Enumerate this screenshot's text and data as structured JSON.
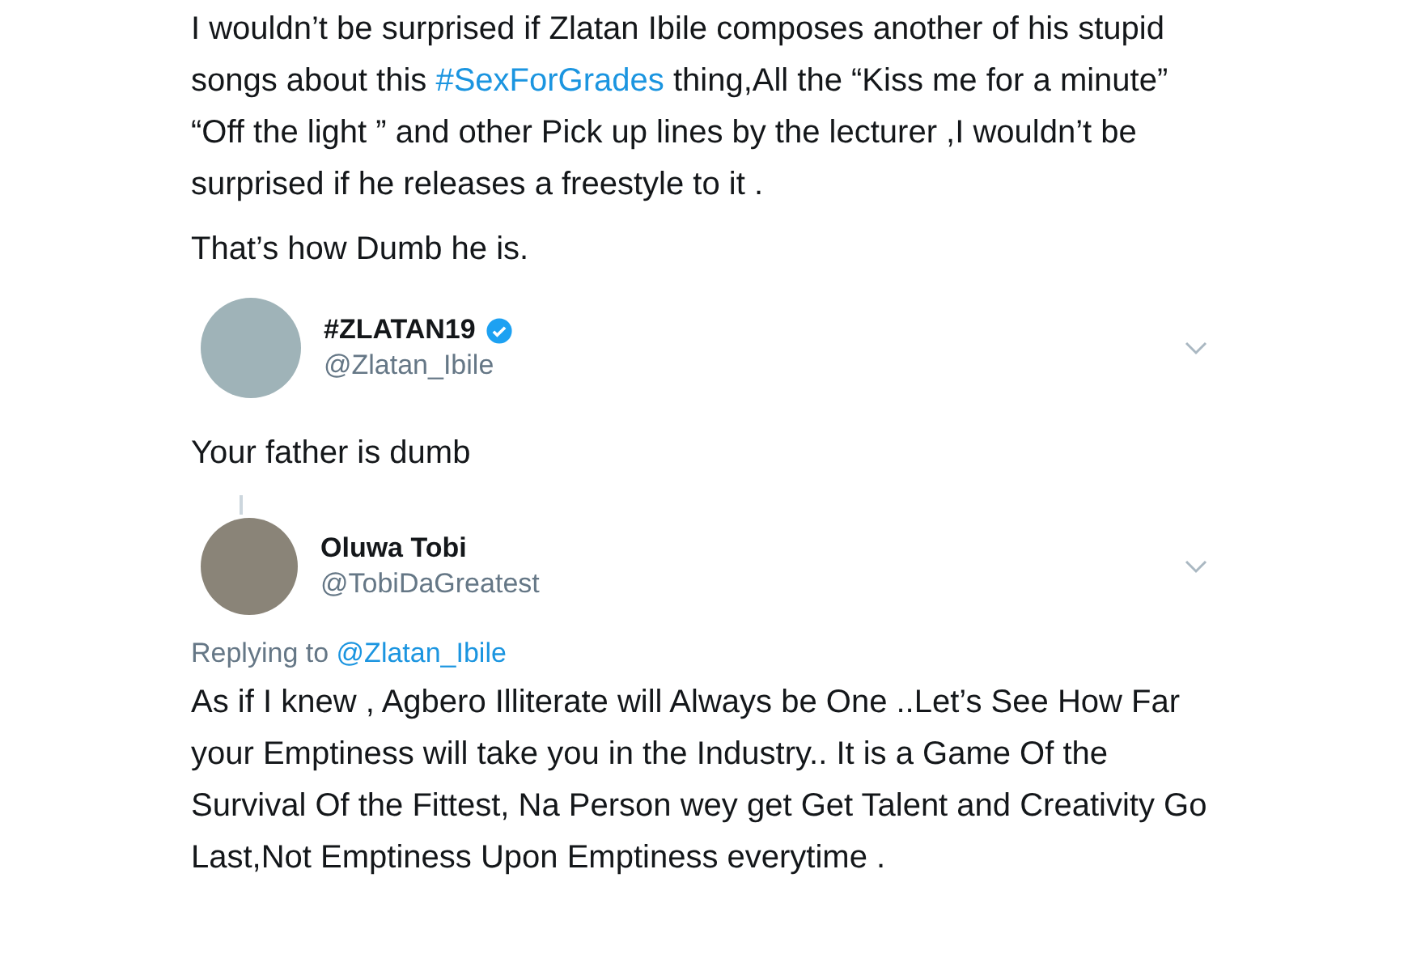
{
  "parent_tweet": {
    "text_before": "I wouldn’t be surprised if Zlatan Ibile composes another of his stupid songs about this",
    "hashtag": "#SexForGrades",
    "text_after": "thing,All the “Kiss me for a minute” “Off the light ” and other Pick up lines by the lecturer ,I wouldn’t be surprised if he releases a freestyle to it .",
    "closing": "That’s how Dumb he is."
  },
  "replies": [
    {
      "name": "#ZLATAN19",
      "verified": true,
      "handle": "@Zlatan_Ibile",
      "thread_line": false,
      "text": "Your father is dumb"
    },
    {
      "name": "Oluwa Tobi",
      "verified": false,
      "handle": "@TobiDaGreatest",
      "thread_line": true,
      "replying_label": "Replying to",
      "replying_to": "@Zlatan_Ibile",
      "text": "As if I knew , Agbero Illiterate will Always be One ..Let’s See How Far your Emptiness will take you in the Industry.. It is a Game Of the Survival Of the Fittest, Na Person wey get Get Talent and Creativity Go Last,Not Emptiness Upon Emptiness everytime ."
    }
  ]
}
